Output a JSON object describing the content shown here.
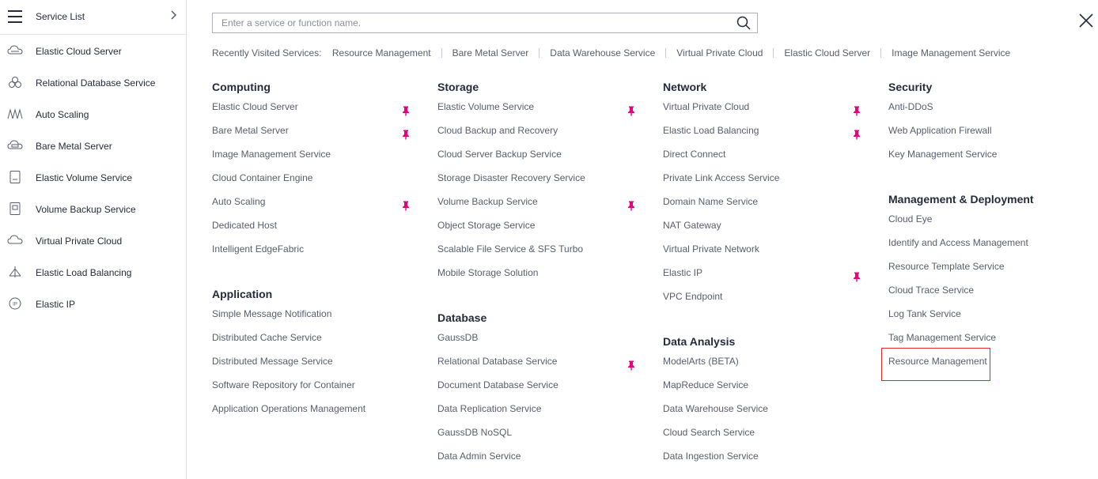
{
  "sidebar": {
    "title": "Service List",
    "items": [
      {
        "label": "Elastic Cloud Server",
        "icon": "cloud-server-icon"
      },
      {
        "label": "Relational Database Service",
        "icon": "database-icon"
      },
      {
        "label": "Auto Scaling",
        "icon": "auto-scaling-icon"
      },
      {
        "label": "Bare Metal Server",
        "icon": "bare-metal-icon"
      },
      {
        "label": "Elastic Volume Service",
        "icon": "volume-icon"
      },
      {
        "label": "Volume Backup Service",
        "icon": "backup-icon"
      },
      {
        "label": "Virtual Private Cloud",
        "icon": "vpc-icon"
      },
      {
        "label": "Elastic Load Balancing",
        "icon": "load-balancer-icon"
      },
      {
        "label": "Elastic IP",
        "icon": "elastic-ip-icon"
      }
    ]
  },
  "search": {
    "placeholder": "Enter a service or function name."
  },
  "recent": {
    "label": "Recently Visited Services:",
    "items": [
      "Resource Management",
      "Bare Metal Server",
      "Data Warehouse Service",
      "Virtual Private Cloud",
      "Elastic Cloud Server",
      "Image Management Service"
    ]
  },
  "categories": {
    "computing": {
      "title": "Computing",
      "services": [
        {
          "label": "Elastic Cloud Server",
          "pinned": true
        },
        {
          "label": "Bare Metal Server",
          "pinned": true
        },
        {
          "label": "Image Management Service",
          "pinned": false
        },
        {
          "label": "Cloud Container Engine",
          "pinned": false
        },
        {
          "label": "Auto Scaling",
          "pinned": true
        },
        {
          "label": "Dedicated Host",
          "pinned": false
        },
        {
          "label": "Intelligent EdgeFabric",
          "pinned": false
        }
      ]
    },
    "application": {
      "title": "Application",
      "services": [
        {
          "label": "Simple Message Notification",
          "pinned": false
        },
        {
          "label": "Distributed Cache Service",
          "pinned": false
        },
        {
          "label": "Distributed Message Service",
          "pinned": false
        },
        {
          "label": "Software Repository for Container",
          "pinned": false
        },
        {
          "label": "Application Operations Management",
          "pinned": false
        }
      ]
    },
    "storage": {
      "title": "Storage",
      "services": [
        {
          "label": "Elastic Volume Service",
          "pinned": true
        },
        {
          "label": "Cloud Backup and Recovery",
          "pinned": false
        },
        {
          "label": "Cloud Server Backup Service",
          "pinned": false
        },
        {
          "label": "Storage Disaster Recovery Service",
          "pinned": false
        },
        {
          "label": "Volume Backup Service",
          "pinned": true
        },
        {
          "label": "Object Storage Service",
          "pinned": false
        },
        {
          "label": "Scalable File Service & SFS Turbo",
          "pinned": false
        },
        {
          "label": "Mobile Storage Solution",
          "pinned": false
        }
      ]
    },
    "database": {
      "title": "Database",
      "services": [
        {
          "label": "GaussDB",
          "pinned": false
        },
        {
          "label": "Relational Database Service",
          "pinned": true
        },
        {
          "label": "Document Database Service",
          "pinned": false
        },
        {
          "label": "Data Replication Service",
          "pinned": false
        },
        {
          "label": "GaussDB NoSQL",
          "pinned": false
        },
        {
          "label": "Data Admin Service",
          "pinned": false
        }
      ]
    },
    "network": {
      "title": "Network",
      "services": [
        {
          "label": "Virtual Private Cloud",
          "pinned": true
        },
        {
          "label": "Elastic Load Balancing",
          "pinned": true
        },
        {
          "label": "Direct Connect",
          "pinned": false
        },
        {
          "label": "Private Link Access Service",
          "pinned": false
        },
        {
          "label": "Domain Name Service",
          "pinned": false
        },
        {
          "label": "NAT Gateway",
          "pinned": false
        },
        {
          "label": "Virtual Private Network",
          "pinned": false
        },
        {
          "label": "Elastic IP",
          "pinned": true
        },
        {
          "label": "VPC Endpoint",
          "pinned": false
        }
      ]
    },
    "data_analysis": {
      "title": "Data Analysis",
      "services": [
        {
          "label": "ModelArts (BETA)",
          "pinned": false
        },
        {
          "label": "MapReduce Service",
          "pinned": false
        },
        {
          "label": "Data Warehouse Service",
          "pinned": false
        },
        {
          "label": "Cloud Search Service",
          "pinned": false
        },
        {
          "label": "Data Ingestion Service",
          "pinned": false
        }
      ]
    },
    "security": {
      "title": "Security",
      "services": [
        {
          "label": "Anti-DDoS",
          "pinned": false
        },
        {
          "label": "Web Application Firewall",
          "pinned": false
        },
        {
          "label": "Key Management Service",
          "pinned": false
        }
      ]
    },
    "management": {
      "title": "Management & Deployment",
      "services": [
        {
          "label": "Cloud Eye",
          "pinned": false
        },
        {
          "label": "Identify and Access Management",
          "pinned": false
        },
        {
          "label": "Resource Template Service",
          "pinned": false
        },
        {
          "label": "Cloud Trace Service",
          "pinned": false
        },
        {
          "label": "Log Tank Service",
          "pinned": false
        },
        {
          "label": "Tag Management Service",
          "pinned": false
        },
        {
          "label": "Resource Management",
          "pinned": false,
          "highlighted": true
        }
      ]
    }
  },
  "colors": {
    "pin": "#e6007a",
    "highlight_border": "#e0282f",
    "text": "#575d6c",
    "heading": "#252b3a"
  }
}
